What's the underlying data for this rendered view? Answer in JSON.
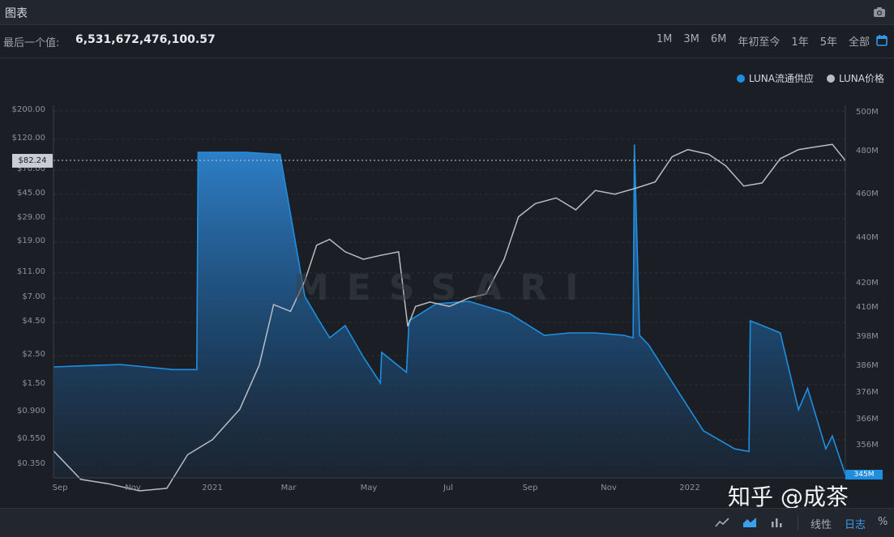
{
  "header": {
    "title": "图表",
    "camera_icon": "camera-icon"
  },
  "info": {
    "label": "最后一个值:",
    "value": "6,531,672,476,100.57"
  },
  "ranges": [
    "1M",
    "3M",
    "6M",
    "年初至今",
    "1年",
    "5年",
    "全部"
  ],
  "legend": [
    {
      "name": "LUNA流通供应",
      "color": "#1e8fe0"
    },
    {
      "name": "LUNA价格",
      "color": "#b8bcc4"
    }
  ],
  "left_axis_ticks": [
    "$200.00",
    "$120.00",
    "$70.00",
    "$45.00",
    "$29.00",
    "$19.00",
    "$11.00",
    "$7.00",
    "$4.50",
    "$2.50",
    "$1.50",
    "$0.900",
    "$0.550",
    "$0.350"
  ],
  "right_axis_ticks": [
    "500M",
    "480M",
    "460M",
    "440M",
    "420M",
    "410M",
    "398M",
    "386M",
    "376M",
    "366M",
    "356M"
  ],
  "x_ticks": [
    "Sep",
    "Nov",
    "2021",
    "Mar",
    "May",
    "Jul",
    "Sep",
    "Nov",
    "2022"
  ],
  "current_price_tag": "$82.24",
  "current_supply_tag": "345M",
  "watermark": "MESSARI",
  "overlay_credit": "知乎 @成茶",
  "bottom": {
    "linear": "线性",
    "log": "日志",
    "percent": "%"
  },
  "chart_data": {
    "type": "line",
    "series": [
      {
        "name": "LUNA价格",
        "axis": "left",
        "scale": "log",
        "x": [
          "2020-08-20",
          "2020-09-10",
          "2020-10-01",
          "2020-10-25",
          "2020-11-15",
          "2020-12-01",
          "2020-12-20",
          "2021-01-10",
          "2021-01-25",
          "2021-02-05",
          "2021-02-18",
          "2021-03-01",
          "2021-03-10",
          "2021-03-20",
          "2021-04-01",
          "2021-04-15",
          "2021-04-28",
          "2021-05-12",
          "2021-05-19",
          "2021-05-25",
          "2021-06-05",
          "2021-06-20",
          "2021-07-05",
          "2021-07-18",
          "2021-08-01",
          "2021-08-12",
          "2021-08-25",
          "2021-09-10",
          "2021-09-25",
          "2021-10-10",
          "2021-10-25",
          "2021-11-10",
          "2021-11-25",
          "2021-12-08",
          "2021-12-20",
          "2022-01-05",
          "2022-01-18",
          "2022-02-01",
          "2022-02-15",
          "2022-03-01",
          "2022-03-15",
          "2022-03-28",
          "2022-04-10",
          "2022-04-20"
        ],
        "values": [
          0.45,
          0.27,
          0.25,
          0.22,
          0.23,
          0.42,
          0.55,
          0.95,
          2.1,
          6.2,
          5.5,
          9.5,
          18,
          20,
          16,
          14,
          15,
          16,
          4.2,
          6.0,
          6.5,
          6.0,
          7.0,
          7.5,
          14,
          30,
          38,
          42,
          34,
          48,
          45,
          50,
          56,
          88,
          100,
          92,
          75,
          52,
          55,
          85,
          100,
          105,
          110,
          82.24
        ]
      },
      {
        "name": "LUNA流通供应",
        "axis": "right",
        "x": [
          "2020-08-20",
          "2020-10-10",
          "2020-11-20",
          "2020-12-08",
          "2020-12-09",
          "2021-01-15",
          "2021-02-10",
          "2021-03-01",
          "2021-03-12",
          "2021-03-20",
          "2021-04-01",
          "2021-04-15",
          "2021-04-28",
          "2021-04-29",
          "2021-05-18",
          "2021-05-20",
          "2021-06-10",
          "2021-07-05",
          "2021-08-05",
          "2021-09-01",
          "2021-09-20",
          "2021-10-10",
          "2021-11-01",
          "2021-11-08",
          "2021-11-09",
          "2021-11-13",
          "2021-11-20",
          "2021-12-15",
          "2022-01-01",
          "2022-01-25",
          "2022-02-05",
          "2022-02-06",
          "2022-02-20",
          "2022-03-01",
          "2022-03-15",
          "2022-03-22",
          "2022-04-05",
          "2022-04-10",
          "2022-04-20"
        ],
        "values": [
          386,
          387,
          385,
          385,
          480,
          480,
          479,
          415,
          405,
          398,
          403,
          390,
          380,
          392,
          384,
          405,
          412,
          413,
          408,
          399,
          400,
          400,
          399,
          398,
          484,
          399,
          395,
          375,
          362,
          355,
          354,
          405,
          402,
          400,
          370,
          378,
          355,
          360,
          345
        ]
      }
    ],
    "left_ylabel_ticks": [
      "$200.00",
      "$120.00",
      "$70.00",
      "$45.00",
      "$29.00",
      "$19.00",
      "$11.00",
      "$7.00",
      "$4.50",
      "$2.50",
      "$1.50",
      "$0.900",
      "$0.550",
      "$0.350"
    ],
    "right_ylabel_ticks": [
      "500M",
      "480M",
      "460M",
      "440M",
      "420M",
      "410M",
      "398M",
      "386M",
      "376M",
      "366M",
      "356M"
    ],
    "grid": true,
    "legend_position": "top-right"
  }
}
